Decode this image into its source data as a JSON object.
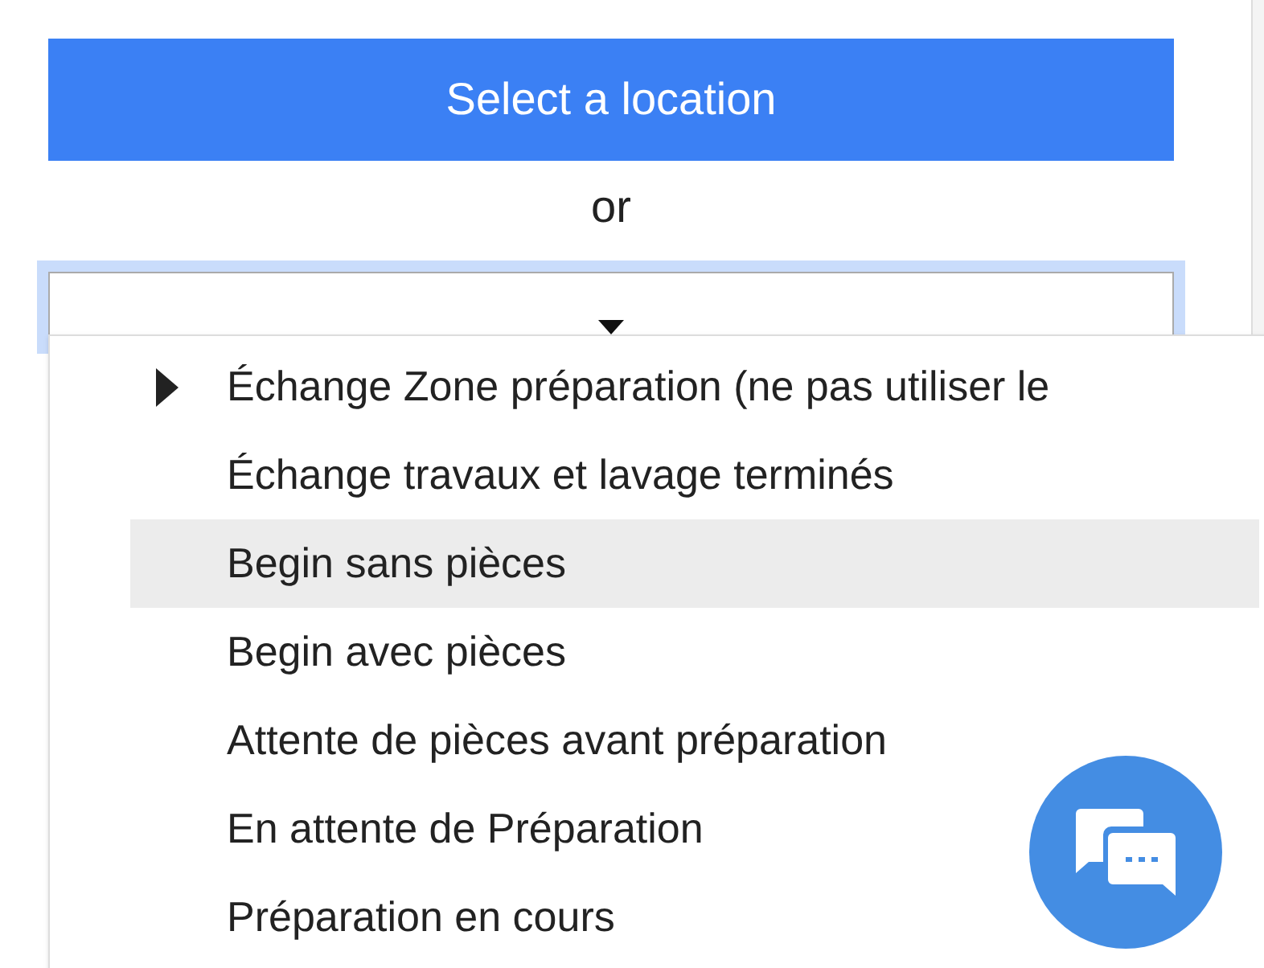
{
  "select_button": {
    "label": "Select a location"
  },
  "separator": "or",
  "dropdown": {
    "expanded": true,
    "options": [
      {
        "label": "Échange Zone préparation (ne pas utiliser le",
        "kind": "submenu",
        "selected": false
      },
      {
        "label": "Échange travaux et lavage terminés",
        "kind": "item",
        "selected": false
      },
      {
        "label": "Begin sans pièces",
        "kind": "item",
        "selected": true
      },
      {
        "label": "Begin avec pièces",
        "kind": "item",
        "selected": false
      },
      {
        "label": "Attente de pièces avant préparation",
        "kind": "item",
        "selected": false
      },
      {
        "label": "En attente de Préparation",
        "kind": "item",
        "selected": false
      },
      {
        "label": "Préparation en cours",
        "kind": "item",
        "selected": false
      }
    ]
  }
}
